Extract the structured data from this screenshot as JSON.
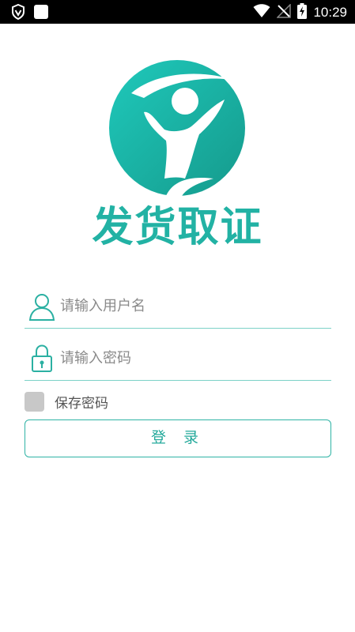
{
  "status_bar": {
    "time": "10:29",
    "icons": [
      "vpn-shield-icon",
      "notification-square-icon",
      "wifi-icon",
      "no-signal-icon",
      "battery-charging-icon"
    ]
  },
  "app": {
    "logo_icon": "person-jumping-logo",
    "title": "发货取证"
  },
  "form": {
    "username": {
      "placeholder": "请输入用户名",
      "value": "",
      "icon": "user-icon"
    },
    "password": {
      "placeholder": "请输入密码",
      "value": "",
      "icon": "lock-icon"
    },
    "remember_label": "保存密码",
    "remember_checked": false,
    "login_label": "登 录"
  },
  "colors": {
    "accent": "#22b2a4",
    "accent_light": "#7cd2c7",
    "status_bar_bg": "#000000",
    "checkbox_bg": "#c8c8c8"
  }
}
